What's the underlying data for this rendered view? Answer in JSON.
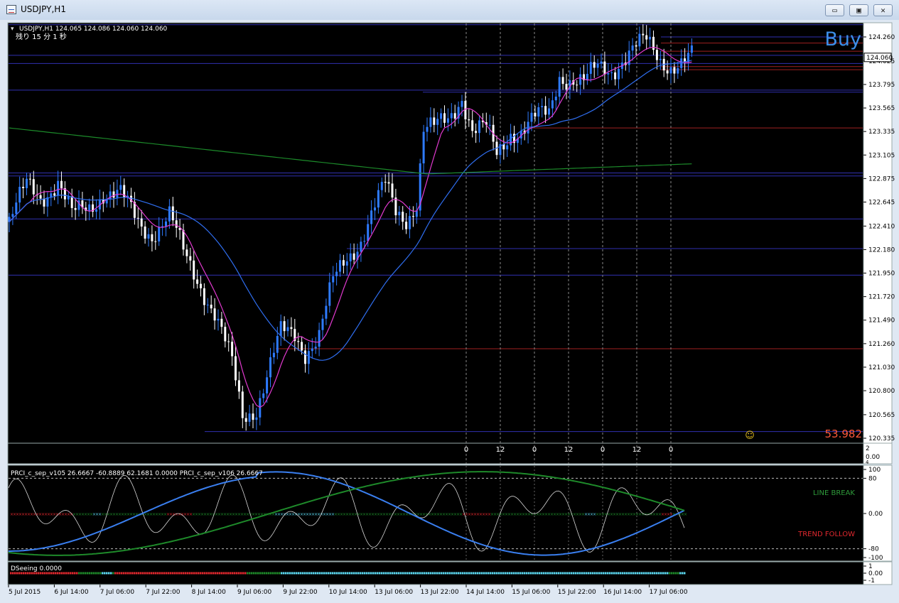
{
  "window": {
    "title": "USDJPY,H1",
    "minimize_glyph": "▭",
    "restore_glyph": "▣",
    "close_glyph": "✕"
  },
  "header": {
    "info": "USDJPY,H1  124.065 124.086 124.060 124.060",
    "timer": "残り 15 分 1 秒"
  },
  "signal": {
    "label": "Buy",
    "color": "#3c8ee8"
  },
  "bottom_value": {
    "label": "53.982",
    "color": "#ff5a3c"
  },
  "smiley": "☺",
  "colors": {
    "candle_up": "#2e7bff",
    "candle_down": "#ffffff",
    "ma_fast": "#e23ad0",
    "ma_mid": "#2f6ef0",
    "ma_slow": "#1c8a2a",
    "level_blue": "#3030b0",
    "level_red": "#a02020",
    "prci_white": "#d8d8d8",
    "prci_blue": "#3a7ff0",
    "prci_green": "#1e8a2a"
  },
  "chart_data": [
    {
      "type": "candlestick",
      "title": "USDJPY,H1",
      "ohlc_last": {
        "open": 124.065,
        "high": 124.086,
        "low": 124.06,
        "close": 124.06
      },
      "price_ticks": [
        "124.260",
        "124.025",
        "123.795",
        "123.565",
        "123.335",
        "123.105",
        "122.875",
        "122.645",
        "122.410",
        "122.180",
        "121.950",
        "121.720",
        "121.490",
        "121.260",
        "121.030",
        "120.800",
        "120.565",
        "120.335"
      ],
      "current_price_label": "124.060",
      "ylim": [
        120.31,
        124.36
      ],
      "close_path": [
        [
          0,
          122.45
        ],
        [
          5,
          122.8
        ],
        [
          9,
          122.7
        ],
        [
          14,
          122.85
        ],
        [
          18,
          122.5
        ],
        [
          23,
          122.6
        ],
        [
          27,
          122.75
        ],
        [
          32,
          122.7
        ],
        [
          37,
          122.45
        ],
        [
          41,
          122.35
        ],
        [
          46,
          122.5
        ],
        [
          50,
          122.15
        ],
        [
          55,
          121.85
        ],
        [
          59,
          121.55
        ],
        [
          64,
          121.05
        ],
        [
          67,
          120.55
        ],
        [
          71,
          120.65
        ],
        [
          75,
          121.05
        ],
        [
          78,
          121.35
        ],
        [
          82,
          121.35
        ],
        [
          85,
          121.2
        ],
        [
          89,
          121.35
        ],
        [
          93,
          121.85
        ],
        [
          97,
          122.1
        ],
        [
          101,
          122.3
        ],
        [
          105,
          122.6
        ],
        [
          108,
          122.8
        ],
        [
          111,
          122.55
        ],
        [
          114,
          122.5
        ],
        [
          117,
          122.65
        ],
        [
          119,
          123.35
        ],
        [
          122,
          123.35
        ],
        [
          126,
          123.45
        ],
        [
          130,
          123.7
        ],
        [
          133,
          123.35
        ],
        [
          137,
          123.35
        ],
        [
          140,
          123.1
        ],
        [
          144,
          123.35
        ],
        [
          147,
          123.35
        ],
        [
          151,
          123.45
        ],
        [
          155,
          123.5
        ],
        [
          158,
          123.9
        ],
        [
          162,
          123.85
        ],
        [
          165,
          123.8
        ],
        [
          169,
          123.95
        ],
        [
          173,
          123.95
        ],
        [
          176,
          124.05
        ],
        [
          180,
          124.15
        ],
        [
          183,
          124.2
        ],
        [
          187,
          124.05
        ],
        [
          190,
          124.0
        ],
        [
          193,
          124.0
        ],
        [
          196,
          124.05
        ]
      ],
      "vertical_separator_labels": [
        "0",
        "12",
        "0",
        "12",
        "0",
        "12",
        "0"
      ],
      "right_marker": "2",
      "right_marker_value": "0.00",
      "right_marker_sub": "4"
    },
    {
      "type": "line",
      "title": "PRCI_c_sep_v105 26.6667 -60.8889 62.1681 0.0000  PRCI_c_sep_v106 26.6667",
      "ylim": [
        -100,
        100
      ],
      "ticks": [
        "100",
        "80",
        "0.00",
        "-80",
        "-100"
      ],
      "labels": [
        {
          "text": "LINE BREAK",
          "color": "#2e9a3a"
        },
        {
          "text": "TREND FOLLOW",
          "color": "#e0282e"
        }
      ]
    },
    {
      "type": "line",
      "title": "DSeeing 0.0000",
      "ticks": [
        "1",
        "0.00",
        "-1"
      ]
    }
  ],
  "time_axis": [
    "5 Jul 2015",
    "6 Jul 14:00",
    "7 Jul 06:00",
    "7 Jul 22:00",
    "8 Jul 14:00",
    "9 Jul 06:00",
    "9 Jul 22:00",
    "10 Jul 14:00",
    "13 Jul 06:00",
    "13 Jul 22:00",
    "14 Jul 14:00",
    "15 Jul 06:00",
    "15 Jul 22:00",
    "16 Jul 14:00",
    "17 Jul 06:00"
  ]
}
